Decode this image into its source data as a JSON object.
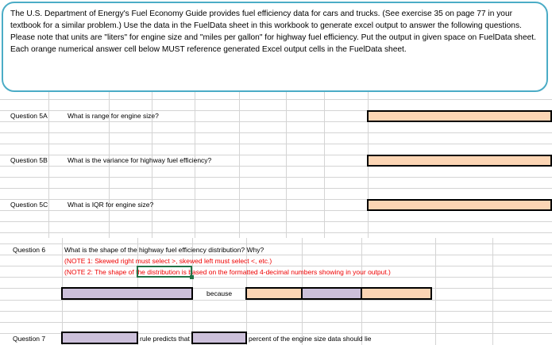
{
  "intro": "The U.S. Department of Energy's Fuel Economy Guide provides fuel efficiency data for cars and trucks.  (See exercise 35 on page 77 in your textbook for a similar problem.)  Use the data in the FuelData sheet in this workbook to generate excel output to answer the following questions.  Please note that units are \"liters\" for engine size and \"miles per gallon\" for highway fuel efficiency.  Put the output in given space on FuelData sheet.  Each orange numerical answer cell below MUST reference generated Excel output cells in the FuelData sheet.",
  "q5a": {
    "label": "Question 5A",
    "text": "What is range for engine size?"
  },
  "q5b": {
    "label": "Question 5B",
    "text": "What is the variance for highway fuel efficiency?"
  },
  "q5c": {
    "label": "Question 5C",
    "text": "What is IQR for engine size?"
  },
  "q6": {
    "label": "Question 6",
    "text": "What is the shape of the highway fuel efficiency distribution?  Why?",
    "note1": "(NOTE 1: Skewed right must select >, skewed left must select <, etc.)",
    "note2": "(NOTE 2: The shape of the distribution is based on the formatted 4-decimal numbers showing in your output.)",
    "because": "because"
  },
  "q7": {
    "label": "Question 7",
    "rule": "rule predicts that",
    "percent": "percent of the engine size data should lie"
  },
  "colors": {
    "orange": "#fcd5b4",
    "purple": "#ccc0da",
    "border": "#4bacc6"
  }
}
